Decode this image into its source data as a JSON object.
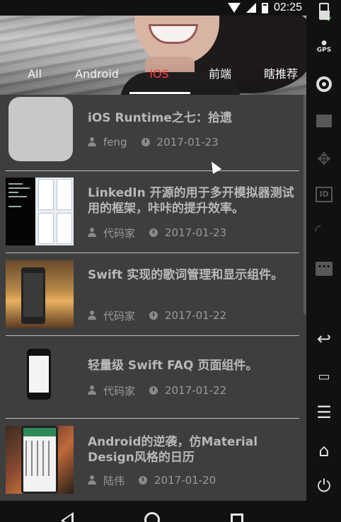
{
  "status_bar": {
    "time": "02:25"
  },
  "tabs": [
    {
      "label": "All",
      "active": false
    },
    {
      "label": "Android",
      "active": false
    },
    {
      "label": "IOS",
      "active": true
    },
    {
      "label": "前端",
      "active": false
    },
    {
      "label": "瞎推荐",
      "active": false
    }
  ],
  "articles": [
    {
      "title": "iOS Runtime之七：拾遗",
      "author": "feng",
      "date": "2017-01-23",
      "thumbnail": "placeholder"
    },
    {
      "title": "LinkedIn 开源的用于多开模拟器测试用的框架，咔咔的提升效率。",
      "author": "代码家",
      "date": "2017-01-23",
      "thumbnail": "developer-screenshot"
    },
    {
      "title": "Swift 实现的歌词管理和显示组件。",
      "author": "代码家",
      "date": "2017-01-22",
      "thumbnail": "lyrics-phone-image"
    },
    {
      "title": "轻量级 Swift FAQ 页面组件。",
      "author": "代码家",
      "date": "2017-01-22",
      "thumbnail": "faq-phone-image"
    },
    {
      "title": "Android的逆袭，仿Material Design风格的日历",
      "author": "陆伟",
      "date": "2017-01-20",
      "thumbnail": "calendar-phone-image"
    }
  ],
  "icons": {
    "author": "user-icon",
    "date": "clock-icon",
    "rail": [
      "battery-icon",
      "gps-icon",
      "camera-icon",
      "clapperboard-icon",
      "move-icon",
      "id-icon",
      "rss-icon",
      "message-icon",
      "back-icon",
      "recent-apps-icon",
      "menu-icon",
      "home-icon",
      "power-icon"
    ]
  },
  "colors": {
    "active_tab": "#ff3b3b",
    "background": "#3e3e3e",
    "divider": "#bfbfbf"
  }
}
